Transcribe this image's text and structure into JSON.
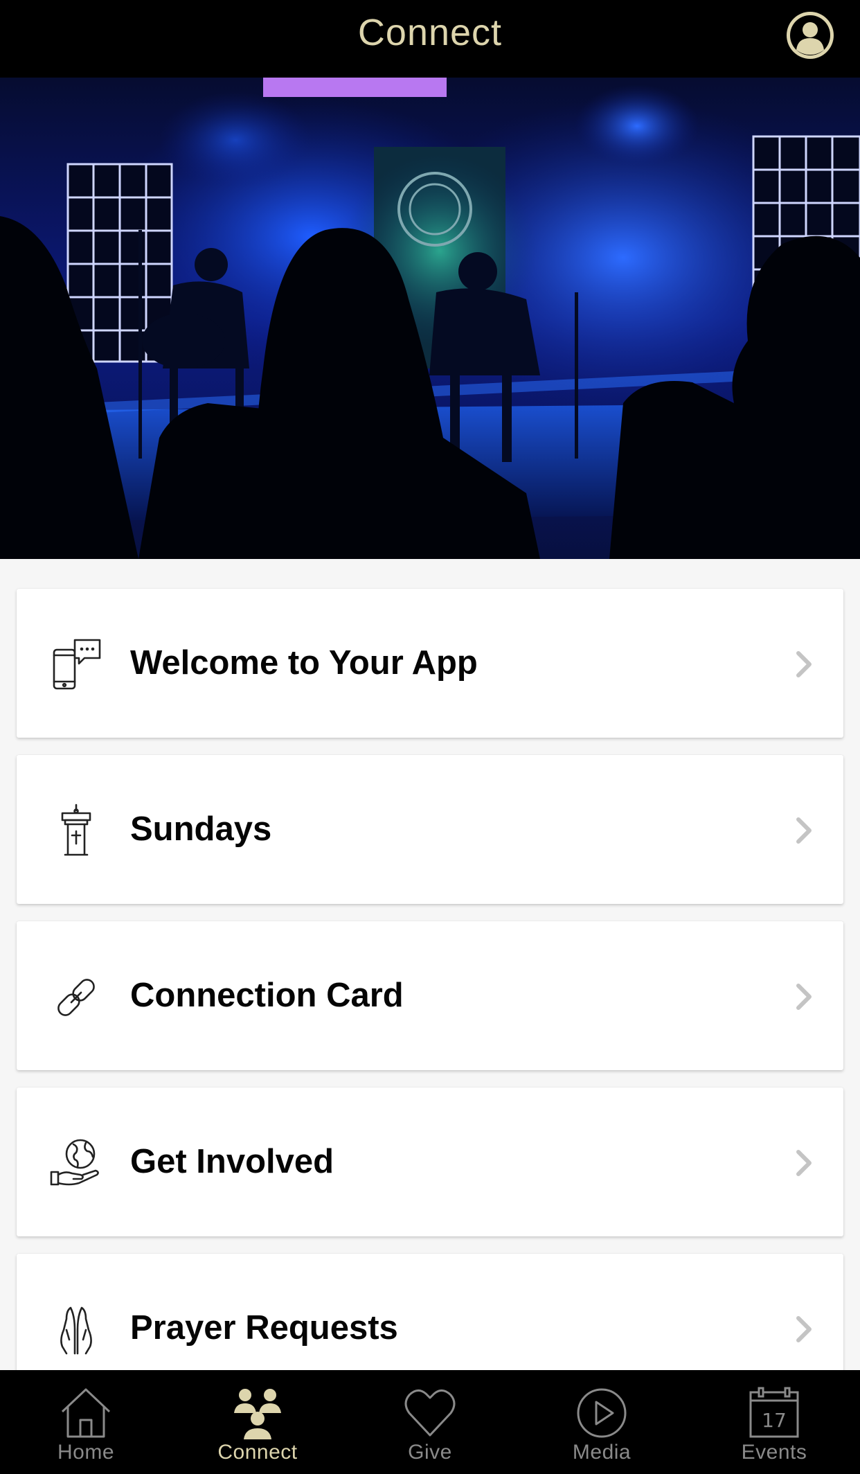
{
  "header": {
    "title": "Connect",
    "profile_icon": "user-circle-icon"
  },
  "hero": {
    "alt": "Worship band on a blue-lit stage with audience silhouettes"
  },
  "menu": [
    {
      "label": "Welcome to Your App",
      "icon": "phone-chat-icon"
    },
    {
      "label": "Sundays",
      "icon": "pulpit-icon"
    },
    {
      "label": "Connection Card",
      "icon": "link-icon"
    },
    {
      "label": "Get Involved",
      "icon": "globe-hand-icon"
    },
    {
      "label": "Prayer Requests",
      "icon": "praying-hands-icon"
    }
  ],
  "tabs": [
    {
      "label": "Home",
      "icon": "home-icon",
      "active": false
    },
    {
      "label": "Connect",
      "icon": "people-icon",
      "active": true
    },
    {
      "label": "Give",
      "icon": "heart-icon",
      "active": false
    },
    {
      "label": "Media",
      "icon": "play-circle-icon",
      "active": false
    },
    {
      "label": "Events",
      "icon": "calendar-icon",
      "active": false,
      "calendar_day": "17"
    }
  ],
  "colors": {
    "accent": "#ddd5ad",
    "bar_bg": "#000000",
    "inactive": "#8a8a8a",
    "page_bg": "#f6f6f6"
  }
}
